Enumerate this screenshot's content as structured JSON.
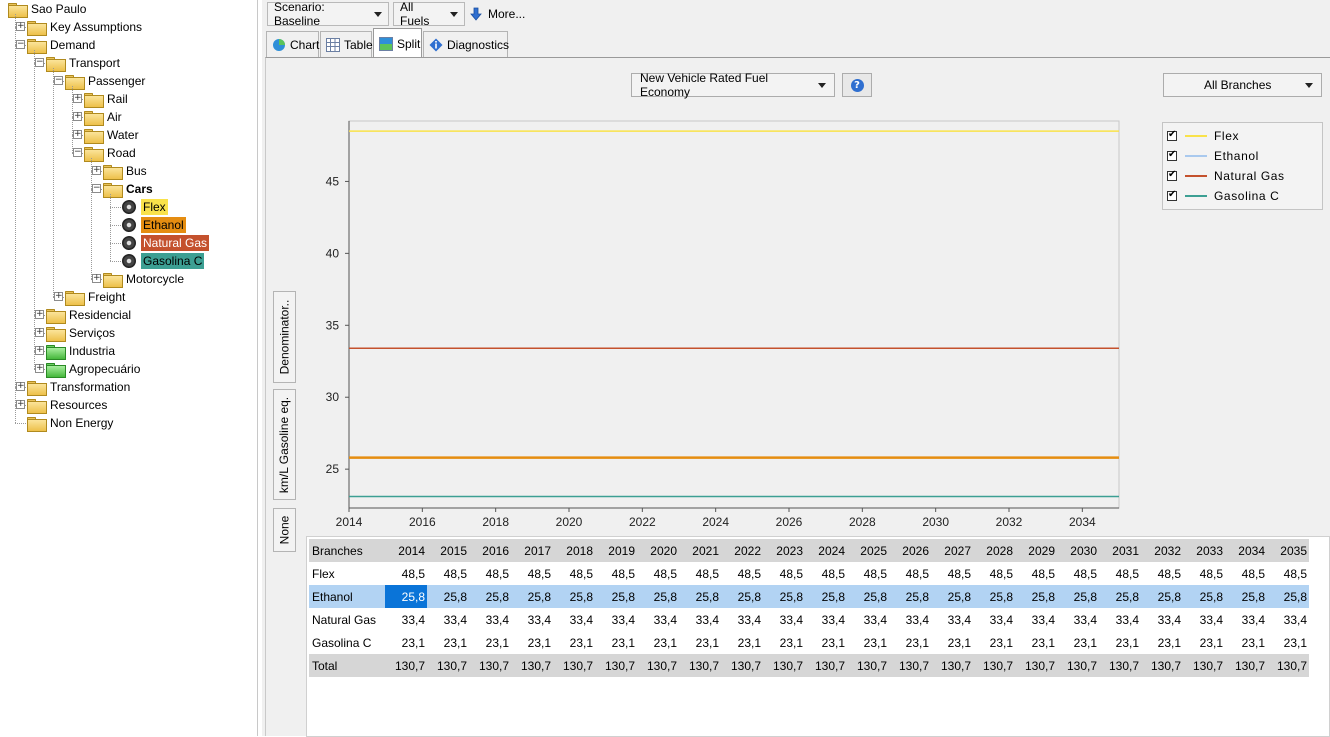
{
  "tree": {
    "items": [
      {
        "label": "Sao Paulo",
        "level": 0,
        "expander": "",
        "folder": "yellow"
      },
      {
        "label": "Key Assumptions",
        "level": 1,
        "expander": "+",
        "folder": "yellow"
      },
      {
        "label": "Demand",
        "level": 1,
        "expander": "−",
        "folder": "yellow"
      },
      {
        "label": "Transport",
        "level": 2,
        "expander": "−",
        "folder": "yellow"
      },
      {
        "label": "Passenger",
        "level": 3,
        "expander": "−",
        "folder": "yellow"
      },
      {
        "label": "Rail",
        "level": 4,
        "expander": "+",
        "folder": "yellow"
      },
      {
        "label": "Air",
        "level": 4,
        "expander": "+",
        "folder": "yellow"
      },
      {
        "label": "Water",
        "level": 4,
        "expander": "+",
        "folder": "yellow"
      },
      {
        "label": "Road",
        "level": 4,
        "expander": "−",
        "folder": "yellow"
      },
      {
        "label": "Bus",
        "level": 5,
        "expander": "+",
        "folder": "yellow"
      },
      {
        "label": "Cars",
        "level": 5,
        "expander": "−",
        "folder": "yellow",
        "bold": true
      },
      {
        "label": "Flex",
        "level": 6,
        "expander": "",
        "folder": "gear",
        "highlight": "#f9e24a",
        "text_color": "#000000"
      },
      {
        "label": "Ethanol",
        "level": 6,
        "expander": "",
        "folder": "gear",
        "highlight": "#e58d11",
        "text_color": "#000000"
      },
      {
        "label": "Natural Gas",
        "level": 6,
        "expander": "",
        "folder": "gear",
        "highlight": "#c4512d",
        "text_color": "#ffffff"
      },
      {
        "label": "Gasolina C",
        "level": 6,
        "expander": "",
        "folder": "gear",
        "highlight": "#3c9f93",
        "text_color": "#000000"
      },
      {
        "label": "Motorcycle",
        "level": 5,
        "expander": "+",
        "folder": "yellow"
      },
      {
        "label": "Freight",
        "level": 3,
        "expander": "+",
        "folder": "yellow"
      },
      {
        "label": "Residencial",
        "level": 2,
        "expander": "+",
        "folder": "yellow"
      },
      {
        "label": "Serviços",
        "level": 2,
        "expander": "+",
        "folder": "yellow"
      },
      {
        "label": "Industria",
        "level": 2,
        "expander": "+",
        "folder": "green"
      },
      {
        "label": "Agropecuário",
        "level": 2,
        "expander": "+",
        "folder": "green"
      },
      {
        "label": "Transformation",
        "level": 1,
        "expander": "+",
        "folder": "yellow"
      },
      {
        "label": "Resources",
        "level": 1,
        "expander": "+",
        "folder": "yellow"
      },
      {
        "label": "Non Energy",
        "level": 1,
        "expander": "",
        "folder": "yellow"
      }
    ]
  },
  "toolbar": {
    "scenario_label": "Scenario: Baseline",
    "fuels_label": "All Fuels",
    "more_label": "More..."
  },
  "tabs": [
    {
      "label": "Chart",
      "icon": "chart-icon",
      "active": false
    },
    {
      "label": "Table",
      "icon": "table-icon",
      "active": false
    },
    {
      "label": "Split",
      "icon": "split-icon",
      "active": true
    },
    {
      "label": "Diagnostics",
      "icon": "diagnostics-icon",
      "active": false
    }
  ],
  "panel": {
    "variable_label": "New Vehicle Rated Fuel Economy",
    "branches_label": "All Branches",
    "vtabs": [
      "Denominator..",
      "km/L Gasoline eq.",
      "None"
    ]
  },
  "chart_data": {
    "type": "line",
    "x": [
      2014,
      2015,
      2016,
      2017,
      2018,
      2019,
      2020,
      2021,
      2022,
      2023,
      2024,
      2025,
      2026,
      2027,
      2028,
      2029,
      2030,
      2031,
      2032,
      2033,
      2034,
      2035
    ],
    "xticks": [
      2014,
      2016,
      2018,
      2020,
      2022,
      2024,
      2026,
      2028,
      2030,
      2032,
      2034
    ],
    "yticks": [
      25,
      30,
      35,
      40,
      45
    ],
    "ylim": [
      22.3,
      49.2
    ],
    "xlim": [
      2014,
      2035
    ],
    "ylabel": "km/L Gasoline eq.",
    "legend_position": "top-right",
    "series": [
      {
        "name": "Flex",
        "color": "#f9e24a",
        "values": [
          48.5,
          48.5,
          48.5,
          48.5,
          48.5,
          48.5,
          48.5,
          48.5,
          48.5,
          48.5,
          48.5,
          48.5,
          48.5,
          48.5,
          48.5,
          48.5,
          48.5,
          48.5,
          48.5,
          48.5,
          48.5,
          48.5
        ]
      },
      {
        "name": "Ethanol",
        "color": "#e58d11",
        "legend_color": "#a9c9ee",
        "values": [
          25.8,
          25.8,
          25.8,
          25.8,
          25.8,
          25.8,
          25.8,
          25.8,
          25.8,
          25.8,
          25.8,
          25.8,
          25.8,
          25.8,
          25.8,
          25.8,
          25.8,
          25.8,
          25.8,
          25.8,
          25.8,
          25.8
        ]
      },
      {
        "name": "Natural Gas",
        "color": "#c4512d",
        "values": [
          33.4,
          33.4,
          33.4,
          33.4,
          33.4,
          33.4,
          33.4,
          33.4,
          33.4,
          33.4,
          33.4,
          33.4,
          33.4,
          33.4,
          33.4,
          33.4,
          33.4,
          33.4,
          33.4,
          33.4,
          33.4,
          33.4
        ]
      },
      {
        "name": "Gasolina C",
        "color": "#3c9f93",
        "values": [
          23.1,
          23.1,
          23.1,
          23.1,
          23.1,
          23.1,
          23.1,
          23.1,
          23.1,
          23.1,
          23.1,
          23.1,
          23.1,
          23.1,
          23.1,
          23.1,
          23.1,
          23.1,
          23.1,
          23.1,
          23.1,
          23.1
        ]
      }
    ]
  },
  "table": {
    "header_label": "Branches",
    "years": [
      "2014",
      "2015",
      "2016",
      "2017",
      "2018",
      "2019",
      "2020",
      "2021",
      "2022",
      "2023",
      "2024",
      "2025",
      "2026",
      "2027",
      "2028",
      "2029",
      "2030",
      "2031",
      "2032",
      "2033",
      "2034",
      "2035"
    ],
    "rows": [
      {
        "name": "Flex",
        "value": "48,5"
      },
      {
        "name": "Ethanol",
        "value": "25,8",
        "selected": true
      },
      {
        "name": "Natural Gas",
        "value": "33,4"
      },
      {
        "name": "Gasolina C",
        "value": "23,1"
      }
    ],
    "total": {
      "name": "Total",
      "value": "130,7"
    }
  }
}
